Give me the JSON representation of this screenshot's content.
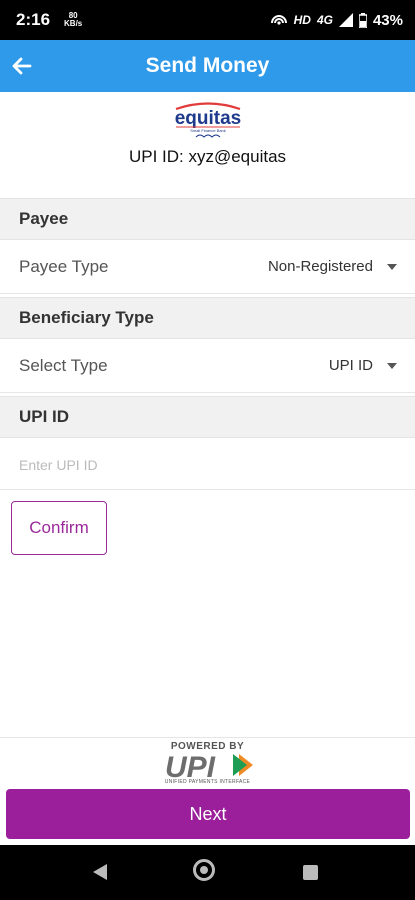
{
  "status_bar": {
    "time": "2:16",
    "speed_value": "80",
    "speed_unit": "KB/s",
    "network_hd": "HD",
    "network_type": "4G",
    "battery": "43%"
  },
  "app_bar": {
    "title": "Send Money"
  },
  "brand": {
    "logo_text": "equitas",
    "logo_subtext": "Small Finance Bank",
    "upi_id_text": "UPI ID: xyz@equitas"
  },
  "payee": {
    "header": "Payee",
    "type_label": "Payee Type",
    "type_value": "Non-Registered"
  },
  "beneficiary": {
    "header": "Beneficiary Type",
    "select_label": "Select Type",
    "select_value": "UPI ID"
  },
  "upi": {
    "header": "UPI ID",
    "input_placeholder": "Enter UPI ID",
    "input_value": ""
  },
  "confirm_label": "Confirm",
  "footer": {
    "powered_by": "POWERED BY",
    "upi_logo_text": "UPI",
    "upi_tagline": "UNIFIED PAYMENTS INTERFACE"
  },
  "next_label": "Next",
  "colors": {
    "app_bar": "#2f9aea",
    "accent_purple": "#9b1f9b",
    "section_bg": "#f1f1f1"
  }
}
